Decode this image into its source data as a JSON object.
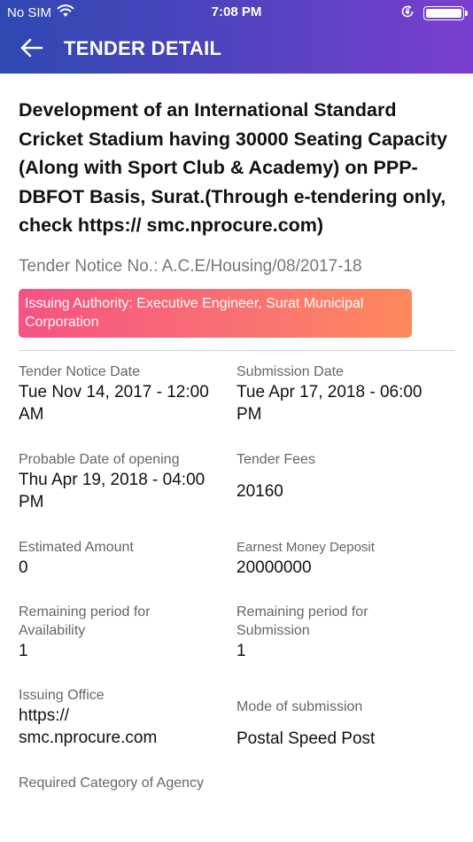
{
  "status_bar": {
    "carrier": "No SIM",
    "time": "7:08 PM",
    "colors": {
      "header_start": "#2f49b3",
      "header_end": "#7a3fcf"
    }
  },
  "nav": {
    "back_icon": "arrow-left-icon",
    "title": "TENDER DETAIL"
  },
  "tender": {
    "title": "Development of an International Standard Cricket Stadium having 30000 Seating Capacity (Along with Sport Club & Academy) on PPP-DBFOT Basis, Surat.(Through e-tendering only, check https:// smc.nprocure.com)",
    "notice_no": "Tender Notice No.: A.C.E/Housing/08/2017-18",
    "authority": "Issuing Authority: Executive Engineer, Surat Municipal Corporation",
    "authority_colors": {
      "start": "#f65283",
      "end": "#fd8a5c"
    }
  },
  "details": {
    "notice_date": {
      "label": "Tender Notice Date",
      "value": "Tue Nov 14, 2017 - 12:00 AM"
    },
    "submission_date": {
      "label": "Submission Date",
      "value": "Tue Apr 17, 2018 - 06:00 PM"
    },
    "opening_date": {
      "label": "Probable Date of opening",
      "value": "Thu Apr 19, 2018 - 04:00 PM"
    },
    "tender_fees": {
      "label": "Tender Fees",
      "value": "20160"
    },
    "estimated_amount": {
      "label": "Estimated Amount",
      "value": "0"
    },
    "emd": {
      "label": "Earnest Money Deposit",
      "value": "20000000"
    },
    "remaining_availability": {
      "label": "Remaining period for Availability",
      "value": "1"
    },
    "remaining_submission": {
      "label": "Remaining period for Submission",
      "value": "1"
    },
    "issuing_office": {
      "label": "Issuing Office",
      "value": "https:// smc.nprocure.com"
    },
    "mode_of_submission": {
      "label": "Mode of submission",
      "value": "Postal Speed Post"
    },
    "required_category": {
      "label": "Required Category of Agency"
    }
  }
}
